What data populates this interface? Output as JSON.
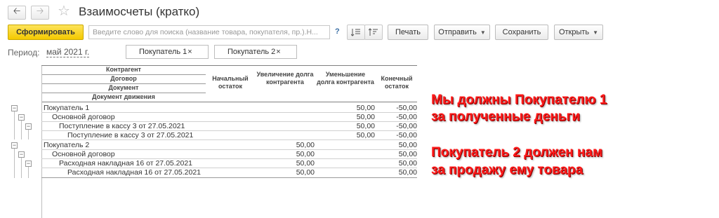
{
  "window": {
    "title": "Взаимосчеты (кратко)"
  },
  "toolbar": {
    "generate_label": "Сформировать",
    "search_placeholder": "Введите слово для поиска (название товара, покупателя, пр.).Н...",
    "help_label": "?",
    "print_label": "Печать",
    "send_label": "Отправить",
    "save_label": "Сохранить",
    "open_label": "Открыть"
  },
  "filters": {
    "period_label": "Период:",
    "period_value": "май 2021 г.",
    "chips": [
      "Покупатель 1",
      "Покупатель 2"
    ]
  },
  "report": {
    "header": {
      "group_levels": [
        "Контрагент",
        "Договор",
        "Документ",
        "Документ движения"
      ],
      "columns": [
        "Начальный остаток",
        "Увеличение долга контрагента",
        "Уменьшение долга контрагента",
        "Конечный остаток"
      ]
    },
    "rows": [
      {
        "label": "Покупатель 1",
        "start": "",
        "increase": "",
        "decrease": "50,00",
        "end": "-50,00"
      },
      {
        "label": "Основной договор",
        "start": "",
        "increase": "",
        "decrease": "50,00",
        "end": "-50,00"
      },
      {
        "label": "Поступление в кассу 3 от 27.05.2021",
        "start": "",
        "increase": "",
        "decrease": "50,00",
        "end": "-50,00"
      },
      {
        "label": "Поступление в кассу 3 от 27.05.2021",
        "start": "",
        "increase": "",
        "decrease": "50,00",
        "end": "-50,00"
      },
      {
        "label": "Покупатель 2",
        "start": "",
        "increase": "50,00",
        "decrease": "",
        "end": "50,00"
      },
      {
        "label": "Основной договор",
        "start": "",
        "increase": "50,00",
        "decrease": "",
        "end": "50,00"
      },
      {
        "label": "Расходная накладная 16  от 27.05.2021",
        "start": "",
        "increase": "50,00",
        "decrease": "",
        "end": "50,00"
      },
      {
        "label": "Расходная накладная 16  от 27.05.2021",
        "start": "",
        "increase": "50,00",
        "decrease": "",
        "end": "50,00"
      }
    ]
  },
  "annotations": {
    "note1_line1": "Мы должны Покупателю 1",
    "note1_line2": "за полученные деньги",
    "note2_line1": "Покупатель 2 должен нам",
    "note2_line2": "за продажу ему товара"
  }
}
